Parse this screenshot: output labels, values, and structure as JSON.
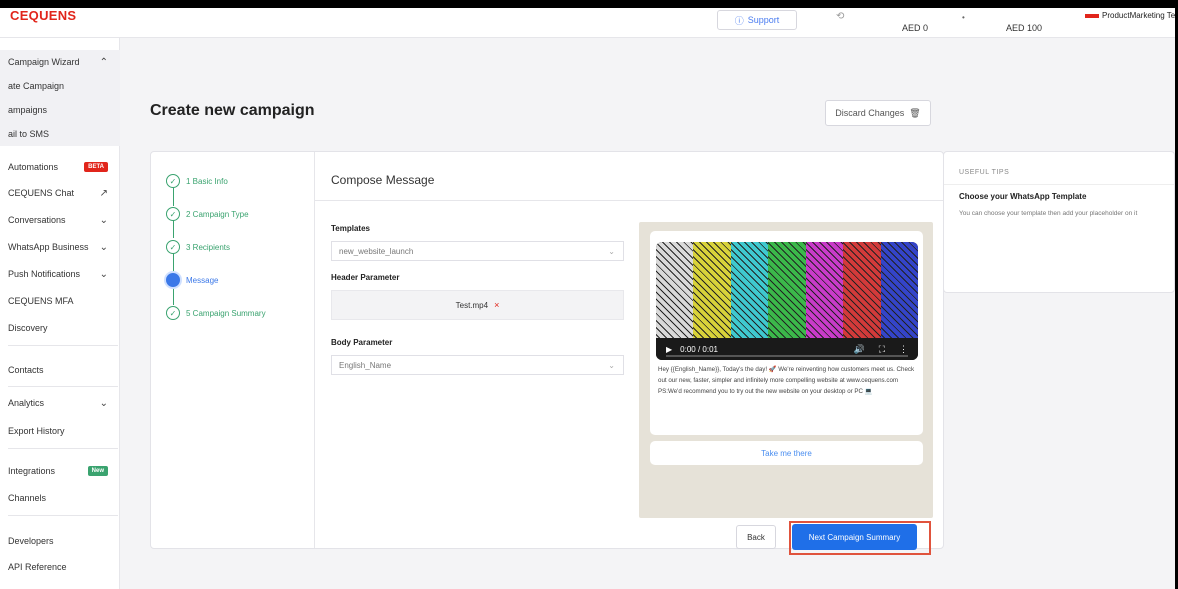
{
  "topbar": {
    "logo": "CEQUENS",
    "support_label": "Support",
    "balance_1": "AED 0",
    "balance_2": "AED 100",
    "user_name": "ProductMarketing Te"
  },
  "sidebar": {
    "items": [
      {
        "label": "Campaign Wizard",
        "chevron": "^"
      },
      {
        "label": "ate Campaign"
      },
      {
        "label": "ampaigns"
      },
      {
        "label": "ail to SMS"
      },
      {
        "label": "Automations",
        "badge": "BETA"
      },
      {
        "label": "CEQUENS Chat",
        "icon": "external-link-icon"
      },
      {
        "label": "Conversations",
        "chevron": "v"
      },
      {
        "label": "WhatsApp Business",
        "chevron": "v"
      },
      {
        "label": "Push Notifications",
        "chevron": "v"
      },
      {
        "label": "CEQUENS MFA"
      },
      {
        "label": "Discovery"
      },
      {
        "label": "Contacts"
      },
      {
        "label": "Analytics",
        "chevron": "v"
      },
      {
        "label": "Export History"
      },
      {
        "label": "Integrations",
        "badge": "New"
      },
      {
        "label": "Channels"
      },
      {
        "label": "Developers"
      },
      {
        "label": "API Reference"
      }
    ]
  },
  "page": {
    "title": "Create new campaign",
    "discard_label": "Discard Changes"
  },
  "steps": [
    {
      "label": "1 Basic Info",
      "state": "done"
    },
    {
      "label": "2 Campaign Type",
      "state": "done"
    },
    {
      "label": "3 Recipients",
      "state": "done"
    },
    {
      "label": "Message",
      "state": "current"
    },
    {
      "label": "5 Campaign Summary",
      "state": "done"
    }
  ],
  "compose": {
    "title": "Compose Message",
    "templates_label": "Templates",
    "templates_value": "new_website_launch",
    "header_label": "Header Parameter",
    "header_file": "Test.mp4",
    "header_remove": "×",
    "body_label": "Body Parameter",
    "body_value": "English_Name"
  },
  "preview": {
    "video_time": "0:00 / 0:01",
    "message": "Hey {{English_Name}}, Today's the day! 🚀 We're reinventing how customers meet us. Check out our new, faster, simpler and infinitely more compelling website at www.cequens.com PS:We'd recommend you to try out the new website on your desktop or PC 💻",
    "cta_label": "Take me there",
    "bar_colors": [
      "#d9d9d9",
      "#d8d23a",
      "#3fc9cf",
      "#3bb84a",
      "#c93bc9",
      "#d23a3a",
      "#3444c9"
    ]
  },
  "actions": {
    "back_label": "Back",
    "next_label": "Next Campaign Summary"
  },
  "tips": {
    "heading": "USEFUL TIPS",
    "title": "Choose your WhatsApp Template",
    "body": "You can choose your template then add your placeholder on it"
  }
}
